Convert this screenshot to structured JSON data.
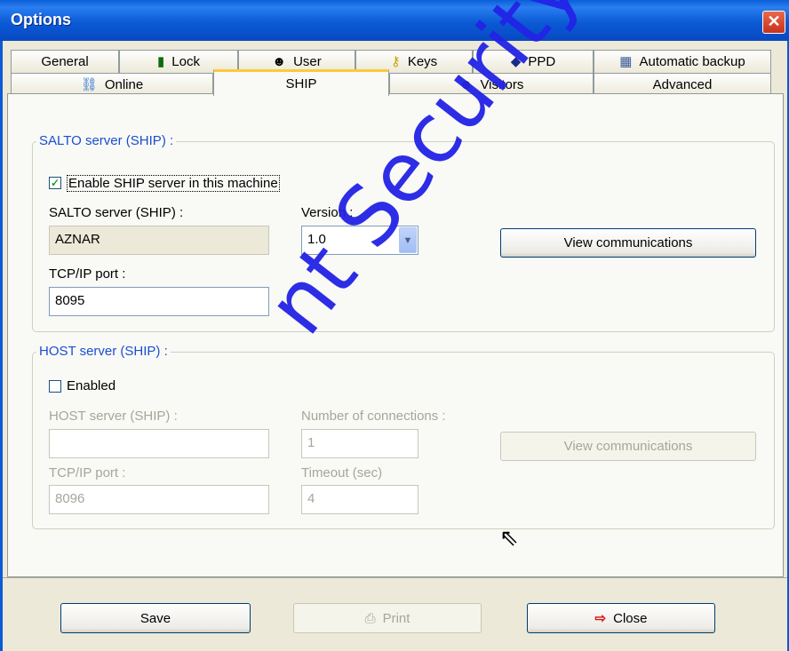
{
  "window": {
    "title": "Options",
    "close_glyph": "✕"
  },
  "tabs_row1": [
    {
      "label": "General",
      "icon": ""
    },
    {
      "label": "Lock",
      "icon": "lock-icon"
    },
    {
      "label": "User",
      "icon": "user-icon"
    },
    {
      "label": "Keys",
      "icon": "keys-icon"
    },
    {
      "label": "PPD",
      "icon": "ppd-icon"
    },
    {
      "label": "Automatic backup",
      "icon": "calendar-icon"
    }
  ],
  "tabs_row2": [
    {
      "label": "Online",
      "icon": "network-icon"
    },
    {
      "label": "SHIP",
      "icon": "",
      "active": true
    },
    {
      "label": "Visitors",
      "icon": "visitors-icon"
    },
    {
      "label": "Advanced",
      "icon": ""
    }
  ],
  "salto": {
    "legend": "SALTO server (SHIP) :",
    "enable_label": "Enable SHIP server in this machine",
    "enable_checked": true,
    "server_label": "SALTO server (SHIP) :",
    "server_value": "AZNAR",
    "version_label": "Version :",
    "version_value": "1.0",
    "port_label": "TCP/IP port :",
    "port_value": "8095",
    "view_comms": "View communications"
  },
  "host": {
    "legend": "HOST server (SHIP) :",
    "enabled_label": "Enabled",
    "enabled_checked": false,
    "server_label": "HOST server (SHIP) :",
    "server_value": "",
    "connections_label": "Number of connections :",
    "connections_value": "1",
    "port_label": "TCP/IP port :",
    "port_value": "8096",
    "timeout_label": "Timeout (sec)",
    "timeout_value": "4",
    "view_comms": "View communications"
  },
  "footer": {
    "save": "Save",
    "print": "Print",
    "close": "Close"
  },
  "watermark": "nt Security & Fire",
  "colors": {
    "accent": "#1a4fd0",
    "titlebar": "#0b5ad6",
    "watermark": "#2323e6"
  }
}
